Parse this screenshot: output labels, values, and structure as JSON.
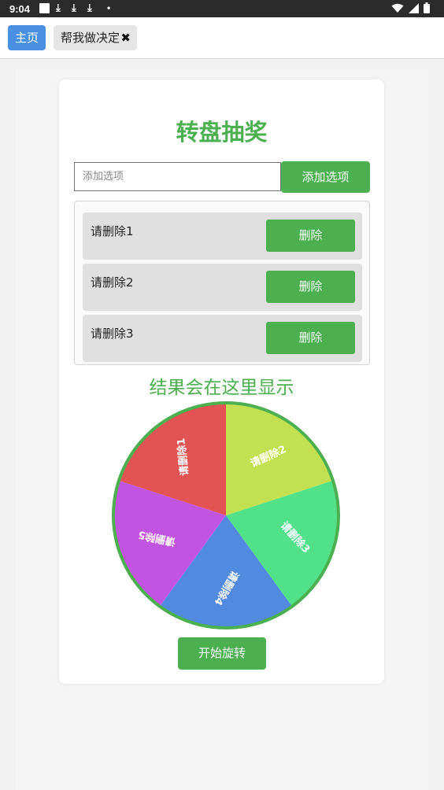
{
  "status": {
    "time": "9:04",
    "icons": [
      "notification-square-icon",
      "download-icon",
      "download-icon",
      "download-icon",
      "dot-icon",
      "wifi-icon",
      "signal-icon",
      "battery-icon"
    ]
  },
  "tabs": {
    "home": "主页",
    "decide": "帮我做决定",
    "close_glyph": "✖"
  },
  "page": {
    "title": "转盘抽奖",
    "input_placeholder": "添加选项",
    "input_value": "",
    "add_label": "添加选项",
    "options": [
      {
        "label": "请删除1",
        "delete_label": "删除"
      },
      {
        "label": "请删除2",
        "delete_label": "删除"
      },
      {
        "label": "请删除3",
        "delete_label": "删除"
      }
    ],
    "result_text": "结果会在这里显示",
    "spin_label": "开始旋转"
  },
  "wheel": {
    "segments": [
      {
        "label": "请删除1",
        "color": "#e25454"
      },
      {
        "label": "请删除2",
        "color": "#c3e053"
      },
      {
        "label": "请删除3",
        "color": "#52e088"
      },
      {
        "label": "请删除4",
        "color": "#528ae0"
      },
      {
        "label": "请删除5",
        "color": "#c154e0"
      }
    ],
    "border_color": "#4caf50"
  },
  "colors": {
    "accent": "#4caf50",
    "home_tab": "#4a90e2"
  }
}
